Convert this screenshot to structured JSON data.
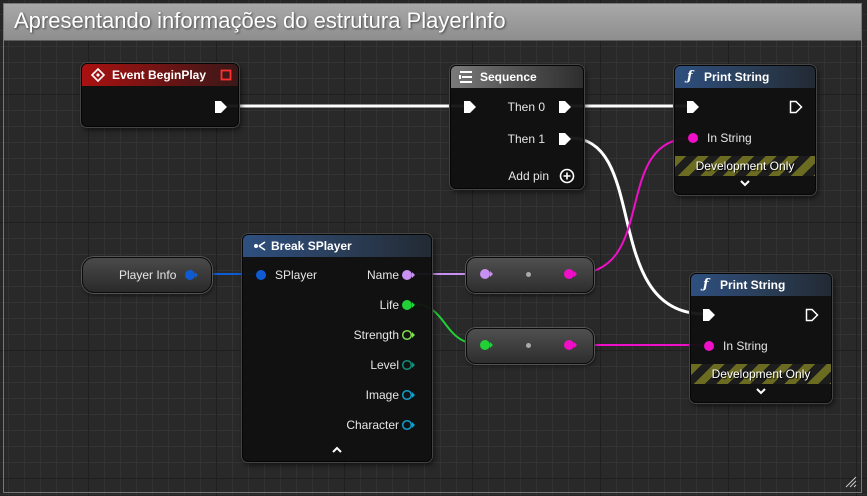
{
  "comment": {
    "title": "Apresentando informações do estrutura PlayerInfo"
  },
  "event_begin_play": {
    "title": "Event BeginPlay"
  },
  "sequence": {
    "title": "Sequence",
    "then0": "Then 0",
    "then1": "Then 1",
    "add_pin": "Add pin"
  },
  "print_string_1": {
    "title": "Print String",
    "in_string": "In String",
    "dev_only": "Development Only"
  },
  "print_string_2": {
    "title": "Print String",
    "in_string": "In String",
    "dev_only": "Development Only"
  },
  "player_info_var": {
    "label": "Player Info"
  },
  "break_splayer": {
    "title": "Break SPlayer",
    "input_pin": "SPlayer",
    "outputs": [
      "Name",
      "Life",
      "Strength",
      "Level",
      "Image",
      "Character"
    ]
  },
  "colors": {
    "exec": "#ffffff",
    "struct": "#0f5bd3",
    "name": "#c890f0",
    "string": "#f00fc8",
    "int": "#20d036",
    "float": "#7ee050",
    "byte": "#0f8f7a",
    "object": "#10a0d0"
  },
  "icons": {
    "event": "diamond-event-icon",
    "sequence": "sequence-icon",
    "function": "function-f-icon",
    "break": "break-struct-icon",
    "add": "plus-circle-icon",
    "expand": "chevron-down-icon",
    "collapse": "chevron-up-icon"
  }
}
